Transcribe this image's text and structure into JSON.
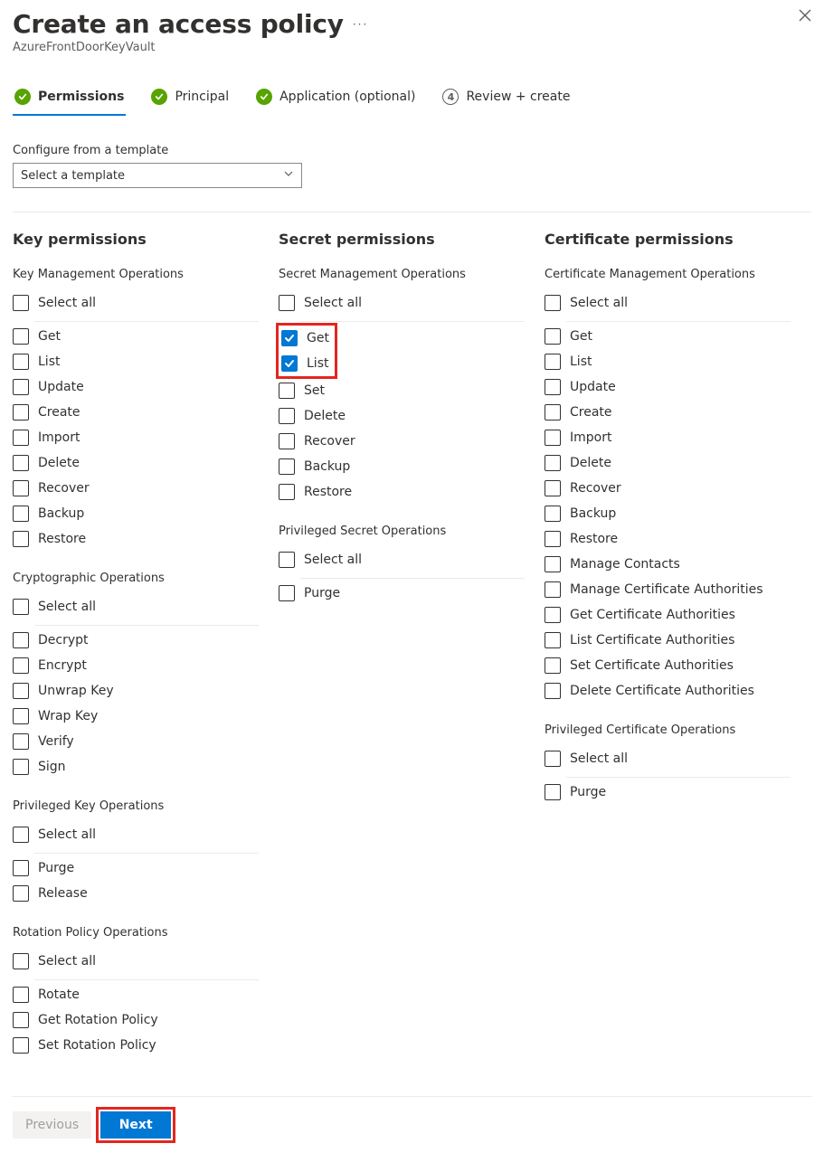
{
  "header": {
    "title": "Create an access policy",
    "subtitle": "AzureFrontDoorKeyVault"
  },
  "tabs": [
    {
      "label": "Permissions",
      "complete": true,
      "active": true
    },
    {
      "label": "Principal",
      "complete": true,
      "active": false
    },
    {
      "label": "Application (optional)",
      "complete": true,
      "active": false
    },
    {
      "label": "Review + create",
      "complete": false,
      "active": false,
      "number": "4"
    }
  ],
  "template": {
    "label": "Configure from a template",
    "placeholder": "Select a template"
  },
  "columns": [
    {
      "heading": "Key permissions",
      "groups": [
        {
          "title": "Key Management Operations",
          "select_all": "Select all",
          "items": [
            {
              "label": "Get"
            },
            {
              "label": "List"
            },
            {
              "label": "Update"
            },
            {
              "label": "Create"
            },
            {
              "label": "Import"
            },
            {
              "label": "Delete"
            },
            {
              "label": "Recover"
            },
            {
              "label": "Backup"
            },
            {
              "label": "Restore"
            }
          ]
        },
        {
          "title": "Cryptographic Operations",
          "select_all": "Select all",
          "items": [
            {
              "label": "Decrypt"
            },
            {
              "label": "Encrypt"
            },
            {
              "label": "Unwrap Key"
            },
            {
              "label": "Wrap Key"
            },
            {
              "label": "Verify"
            },
            {
              "label": "Sign"
            }
          ]
        },
        {
          "title": "Privileged Key Operations",
          "select_all": "Select all",
          "items": [
            {
              "label": "Purge"
            },
            {
              "label": "Release"
            }
          ]
        },
        {
          "title": "Rotation Policy Operations",
          "select_all": "Select all",
          "items": [
            {
              "label": "Rotate"
            },
            {
              "label": "Get Rotation Policy"
            },
            {
              "label": "Set Rotation Policy"
            }
          ]
        }
      ]
    },
    {
      "heading": "Secret permissions",
      "groups": [
        {
          "title": "Secret Management Operations",
          "select_all": "Select all",
          "highlighted_items": [
            0,
            1
          ],
          "items": [
            {
              "label": "Get",
              "checked": true
            },
            {
              "label": "List",
              "checked": true
            },
            {
              "label": "Set"
            },
            {
              "label": "Delete"
            },
            {
              "label": "Recover"
            },
            {
              "label": "Backup"
            },
            {
              "label": "Restore"
            }
          ]
        },
        {
          "title": "Privileged Secret Operations",
          "select_all": "Select all",
          "items": [
            {
              "label": "Purge"
            }
          ]
        }
      ]
    },
    {
      "heading": "Certificate permissions",
      "groups": [
        {
          "title": "Certificate Management Operations",
          "select_all": "Select all",
          "items": [
            {
              "label": "Get"
            },
            {
              "label": "List"
            },
            {
              "label": "Update"
            },
            {
              "label": "Create"
            },
            {
              "label": "Import"
            },
            {
              "label": "Delete"
            },
            {
              "label": "Recover"
            },
            {
              "label": "Backup"
            },
            {
              "label": "Restore"
            },
            {
              "label": "Manage Contacts"
            },
            {
              "label": "Manage Certificate Authorities"
            },
            {
              "label": "Get Certificate Authorities"
            },
            {
              "label": "List Certificate Authorities"
            },
            {
              "label": "Set Certificate Authorities"
            },
            {
              "label": "Delete Certificate Authorities"
            }
          ]
        },
        {
          "title": "Privileged Certificate Operations",
          "select_all": "Select all",
          "items": [
            {
              "label": "Purge"
            }
          ]
        }
      ]
    }
  ],
  "footer": {
    "previous": "Previous",
    "next": "Next"
  }
}
